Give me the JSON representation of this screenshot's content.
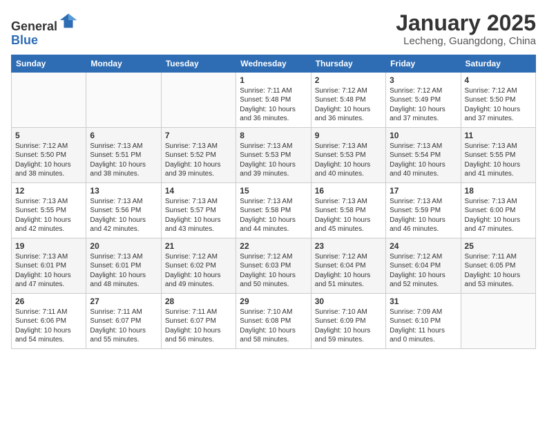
{
  "header": {
    "logo_line1": "General",
    "logo_line2": "Blue",
    "month_title": "January 2025",
    "location": "Lecheng, Guangdong, China"
  },
  "weekdays": [
    "Sunday",
    "Monday",
    "Tuesday",
    "Wednesday",
    "Thursday",
    "Friday",
    "Saturday"
  ],
  "weeks": [
    [
      {
        "day": "",
        "info": ""
      },
      {
        "day": "",
        "info": ""
      },
      {
        "day": "",
        "info": ""
      },
      {
        "day": "1",
        "info": "Sunrise: 7:11 AM\nSunset: 5:48 PM\nDaylight: 10 hours\nand 36 minutes."
      },
      {
        "day": "2",
        "info": "Sunrise: 7:12 AM\nSunset: 5:48 PM\nDaylight: 10 hours\nand 36 minutes."
      },
      {
        "day": "3",
        "info": "Sunrise: 7:12 AM\nSunset: 5:49 PM\nDaylight: 10 hours\nand 37 minutes."
      },
      {
        "day": "4",
        "info": "Sunrise: 7:12 AM\nSunset: 5:50 PM\nDaylight: 10 hours\nand 37 minutes."
      }
    ],
    [
      {
        "day": "5",
        "info": "Sunrise: 7:12 AM\nSunset: 5:50 PM\nDaylight: 10 hours\nand 38 minutes."
      },
      {
        "day": "6",
        "info": "Sunrise: 7:13 AM\nSunset: 5:51 PM\nDaylight: 10 hours\nand 38 minutes."
      },
      {
        "day": "7",
        "info": "Sunrise: 7:13 AM\nSunset: 5:52 PM\nDaylight: 10 hours\nand 39 minutes."
      },
      {
        "day": "8",
        "info": "Sunrise: 7:13 AM\nSunset: 5:53 PM\nDaylight: 10 hours\nand 39 minutes."
      },
      {
        "day": "9",
        "info": "Sunrise: 7:13 AM\nSunset: 5:53 PM\nDaylight: 10 hours\nand 40 minutes."
      },
      {
        "day": "10",
        "info": "Sunrise: 7:13 AM\nSunset: 5:54 PM\nDaylight: 10 hours\nand 40 minutes."
      },
      {
        "day": "11",
        "info": "Sunrise: 7:13 AM\nSunset: 5:55 PM\nDaylight: 10 hours\nand 41 minutes."
      }
    ],
    [
      {
        "day": "12",
        "info": "Sunrise: 7:13 AM\nSunset: 5:55 PM\nDaylight: 10 hours\nand 42 minutes."
      },
      {
        "day": "13",
        "info": "Sunrise: 7:13 AM\nSunset: 5:56 PM\nDaylight: 10 hours\nand 42 minutes."
      },
      {
        "day": "14",
        "info": "Sunrise: 7:13 AM\nSunset: 5:57 PM\nDaylight: 10 hours\nand 43 minutes."
      },
      {
        "day": "15",
        "info": "Sunrise: 7:13 AM\nSunset: 5:58 PM\nDaylight: 10 hours\nand 44 minutes."
      },
      {
        "day": "16",
        "info": "Sunrise: 7:13 AM\nSunset: 5:58 PM\nDaylight: 10 hours\nand 45 minutes."
      },
      {
        "day": "17",
        "info": "Sunrise: 7:13 AM\nSunset: 5:59 PM\nDaylight: 10 hours\nand 46 minutes."
      },
      {
        "day": "18",
        "info": "Sunrise: 7:13 AM\nSunset: 6:00 PM\nDaylight: 10 hours\nand 47 minutes."
      }
    ],
    [
      {
        "day": "19",
        "info": "Sunrise: 7:13 AM\nSunset: 6:01 PM\nDaylight: 10 hours\nand 47 minutes."
      },
      {
        "day": "20",
        "info": "Sunrise: 7:13 AM\nSunset: 6:01 PM\nDaylight: 10 hours\nand 48 minutes."
      },
      {
        "day": "21",
        "info": "Sunrise: 7:12 AM\nSunset: 6:02 PM\nDaylight: 10 hours\nand 49 minutes."
      },
      {
        "day": "22",
        "info": "Sunrise: 7:12 AM\nSunset: 6:03 PM\nDaylight: 10 hours\nand 50 minutes."
      },
      {
        "day": "23",
        "info": "Sunrise: 7:12 AM\nSunset: 6:04 PM\nDaylight: 10 hours\nand 51 minutes."
      },
      {
        "day": "24",
        "info": "Sunrise: 7:12 AM\nSunset: 6:04 PM\nDaylight: 10 hours\nand 52 minutes."
      },
      {
        "day": "25",
        "info": "Sunrise: 7:11 AM\nSunset: 6:05 PM\nDaylight: 10 hours\nand 53 minutes."
      }
    ],
    [
      {
        "day": "26",
        "info": "Sunrise: 7:11 AM\nSunset: 6:06 PM\nDaylight: 10 hours\nand 54 minutes."
      },
      {
        "day": "27",
        "info": "Sunrise: 7:11 AM\nSunset: 6:07 PM\nDaylight: 10 hours\nand 55 minutes."
      },
      {
        "day": "28",
        "info": "Sunrise: 7:11 AM\nSunset: 6:07 PM\nDaylight: 10 hours\nand 56 minutes."
      },
      {
        "day": "29",
        "info": "Sunrise: 7:10 AM\nSunset: 6:08 PM\nDaylight: 10 hours\nand 58 minutes."
      },
      {
        "day": "30",
        "info": "Sunrise: 7:10 AM\nSunset: 6:09 PM\nDaylight: 10 hours\nand 59 minutes."
      },
      {
        "day": "31",
        "info": "Sunrise: 7:09 AM\nSunset: 6:10 PM\nDaylight: 11 hours\nand 0 minutes."
      },
      {
        "day": "",
        "info": ""
      }
    ]
  ]
}
